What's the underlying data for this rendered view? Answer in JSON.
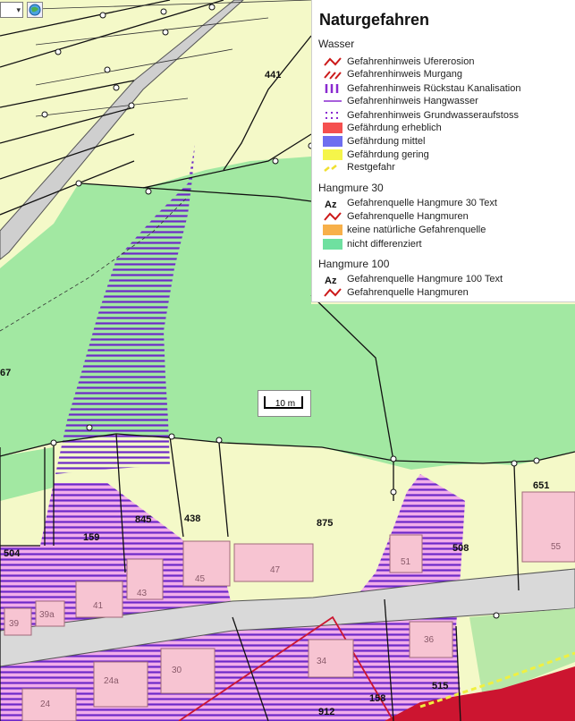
{
  "toolbar": {
    "dropdown_arrow": "▾",
    "globe_icon": "globe-icon"
  },
  "scale": {
    "label": "10 m"
  },
  "legend": {
    "title": "Naturgefahren",
    "sections": [
      {
        "heading": "Wasser",
        "items": [
          {
            "label": "Gefahrenhinweis Ufererosion",
            "symbol": "red-zigzag"
          },
          {
            "label": "Gefahrenhinweis Murgang",
            "symbol": "red-double-dash"
          },
          {
            "label": "Gefahrenhinweis Rückstau Kanalisation",
            "symbol": "purple-vertical-bars"
          },
          {
            "label": "Gefahrenhinweis Hangwasser",
            "symbol": "purple-line"
          },
          {
            "label": "Gefahrenhinweis Grundwasseraufstoss",
            "symbol": "purple-dots"
          },
          {
            "label": "Gefährdung erheblich",
            "symbol": "fill",
            "color": "#f5504f"
          },
          {
            "label": "Gefährdung mittel",
            "symbol": "fill",
            "color": "#6e6ef0"
          },
          {
            "label": "Gefährdung gering",
            "symbol": "fill",
            "color": "#f5f54a"
          },
          {
            "label": "Restgefahr",
            "symbol": "yellow-dash"
          }
        ]
      },
      {
        "heading": "Hangmure 30",
        "items": [
          {
            "label": "Gefahrenquelle Hangmure 30 Text",
            "symbol": "az-text"
          },
          {
            "label": "Gefahrenquelle Hangmuren",
            "symbol": "red-zigzag"
          },
          {
            "label": "keine natürliche Gefahrenquelle",
            "symbol": "fill",
            "color": "#f7b04a"
          },
          {
            "label": "nicht differenziert",
            "symbol": "fill",
            "color": "#6fe0a0"
          }
        ]
      },
      {
        "heading": "Hangmure 100",
        "items": [
          {
            "label": "Gefahrenquelle Hangmure 100 Text",
            "symbol": "az-text"
          },
          {
            "label": "Gefahrenquelle Hangmuren",
            "symbol": "red-zigzag"
          }
        ]
      }
    ]
  },
  "colors": {
    "parcel_bg": "#f4f9c8",
    "green_zone": "#a2e8a2",
    "purple_hatch": "#6c28c8",
    "magenta_zone": "#f0a0f0",
    "building": "#f7c4d2",
    "road": "#d9d9d9",
    "red_zone": "#cc1530"
  },
  "parcels": [
    {
      "id": "p441",
      "label": "441"
    },
    {
      "id": "p67",
      "label": "67"
    },
    {
      "id": "p845",
      "label": "845"
    },
    {
      "id": "p438",
      "label": "438"
    },
    {
      "id": "p875",
      "label": "875"
    },
    {
      "id": "p651",
      "label": "651"
    },
    {
      "id": "p159",
      "label": "159"
    },
    {
      "id": "p504",
      "label": "504"
    },
    {
      "id": "p508",
      "label": "508"
    },
    {
      "id": "p515",
      "label": "515"
    },
    {
      "id": "p158",
      "label": "158"
    },
    {
      "id": "p912",
      "label": "912"
    }
  ],
  "houses": [
    {
      "id": "h47",
      "label": "47"
    },
    {
      "id": "h45",
      "label": "45"
    },
    {
      "id": "h55",
      "label": "55"
    },
    {
      "id": "h51",
      "label": "51"
    },
    {
      "id": "h41",
      "label": "41"
    },
    {
      "id": "h43",
      "label": "43"
    },
    {
      "id": "h39",
      "label": "39"
    },
    {
      "id": "h39a",
      "label": "39a"
    },
    {
      "id": "h36",
      "label": "36"
    },
    {
      "id": "h34",
      "label": "34"
    },
    {
      "id": "h30",
      "label": "30"
    },
    {
      "id": "h24",
      "label": "24"
    },
    {
      "id": "h24a",
      "label": "24a"
    }
  ]
}
